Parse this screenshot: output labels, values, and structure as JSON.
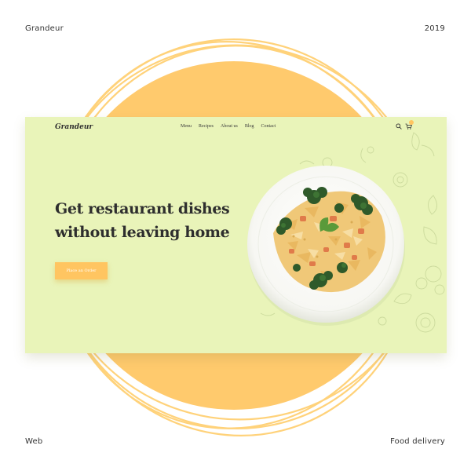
{
  "corners": {
    "top_left": "Grandeur",
    "top_right": "2019",
    "bottom_left": "Web",
    "bottom_right": "Food delivery"
  },
  "nav": {
    "brand": "Grandeur",
    "menu": [
      {
        "label": "Menu"
      },
      {
        "label": "Recipes"
      },
      {
        "label": "About us"
      },
      {
        "label": "Blog"
      },
      {
        "label": "Contact"
      }
    ],
    "icons": [
      "search-icon",
      "cart-icon"
    ]
  },
  "hero": {
    "headline_line1": "Get restaurant dishes",
    "headline_line2": "without leaving home",
    "cta_label": "Place an Order",
    "image": "pasta-plate"
  },
  "colors": {
    "card_background": "#e9f4b9",
    "accent_orange": "#ffc561",
    "ring_orange": "#ffd36e",
    "text_dark": "#2e2e2e"
  }
}
